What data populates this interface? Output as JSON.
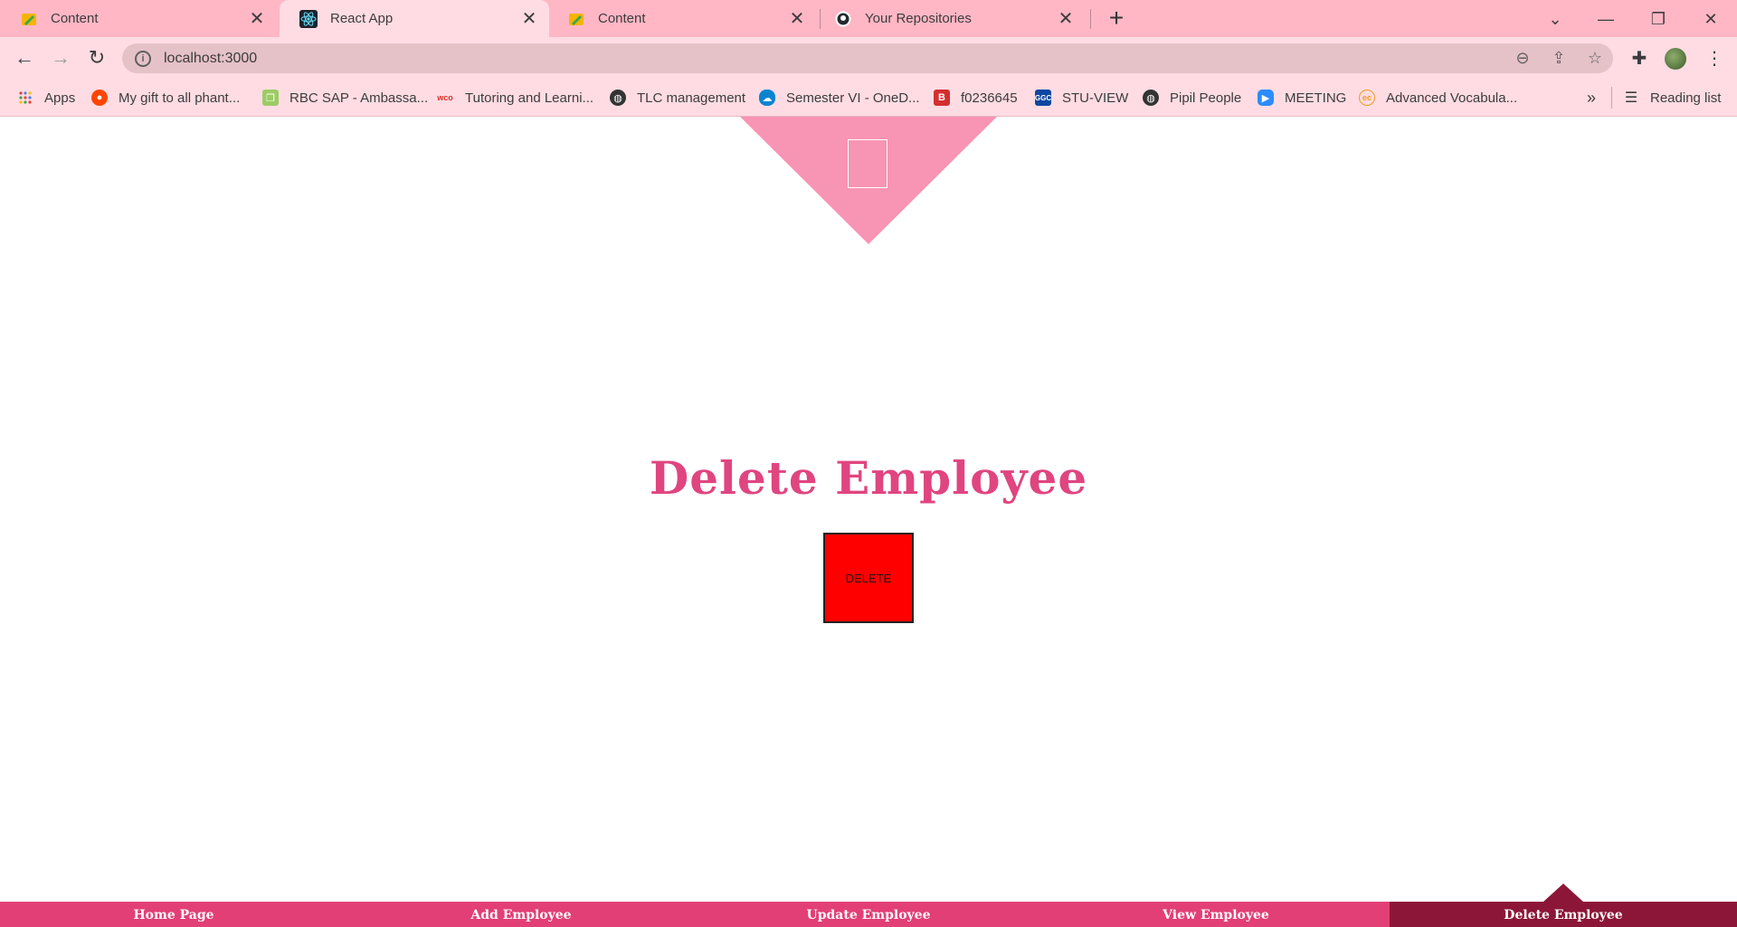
{
  "browser": {
    "tabs": [
      {
        "title": "Content",
        "icon": "pencil-folder-icon",
        "active": false
      },
      {
        "title": "React App",
        "icon": "react-icon",
        "active": true
      },
      {
        "title": "Content",
        "icon": "pencil-folder-icon",
        "active": false
      },
      {
        "title": "Your Repositories",
        "icon": "github-icon",
        "active": false
      }
    ],
    "url": "localhost:3000",
    "bookmarks": [
      {
        "label": "Apps",
        "icon": "apps-grid-icon",
        "color": "#1a73e8"
      },
      {
        "label": "My gift to all phant...",
        "icon": "reddit-icon",
        "color": "#ff4500"
      },
      {
        "label": "RBC SAP - Ambassa...",
        "icon": "chat-bubbles-icon",
        "color": "#7cb342"
      },
      {
        "label": "Tutoring and Learni...",
        "icon": "wco-icon",
        "color": "#d93025"
      },
      {
        "label": "TLC management",
        "icon": "globe-icon",
        "color": "#333333"
      },
      {
        "label": "Semester VI - OneD...",
        "icon": "onedrive-icon",
        "color": "#0a84d0"
      },
      {
        "label": "f0236645",
        "icon": "b-icon",
        "color": "#d32f2f"
      },
      {
        "label": "STU-VIEW",
        "icon": "ggc-icon",
        "color": "#0d47a1"
      },
      {
        "label": "Pipil People",
        "icon": "globe-icon",
        "color": "#333333"
      },
      {
        "label": "MEETING",
        "icon": "zoom-icon",
        "color": "#2d8cff"
      },
      {
        "label": "Advanced Vocabula...",
        "icon": "ec-icon",
        "color": "#f29c1f"
      }
    ],
    "reading_list": "Reading list"
  },
  "page": {
    "heading": "Delete Employee",
    "delete_button": "DELETE",
    "nav": [
      {
        "label": "Home Page",
        "active": false
      },
      {
        "label": "Add Employee",
        "active": false
      },
      {
        "label": "Update Employee",
        "active": false
      },
      {
        "label": "View Employee",
        "active": false
      },
      {
        "label": "Delete Employee",
        "active": true
      }
    ],
    "colors": {
      "accent": "#e23f76",
      "active_nav": "#8c1638",
      "logo": "#f894b4",
      "button": "#ff0000",
      "heading": "#e04580"
    }
  }
}
